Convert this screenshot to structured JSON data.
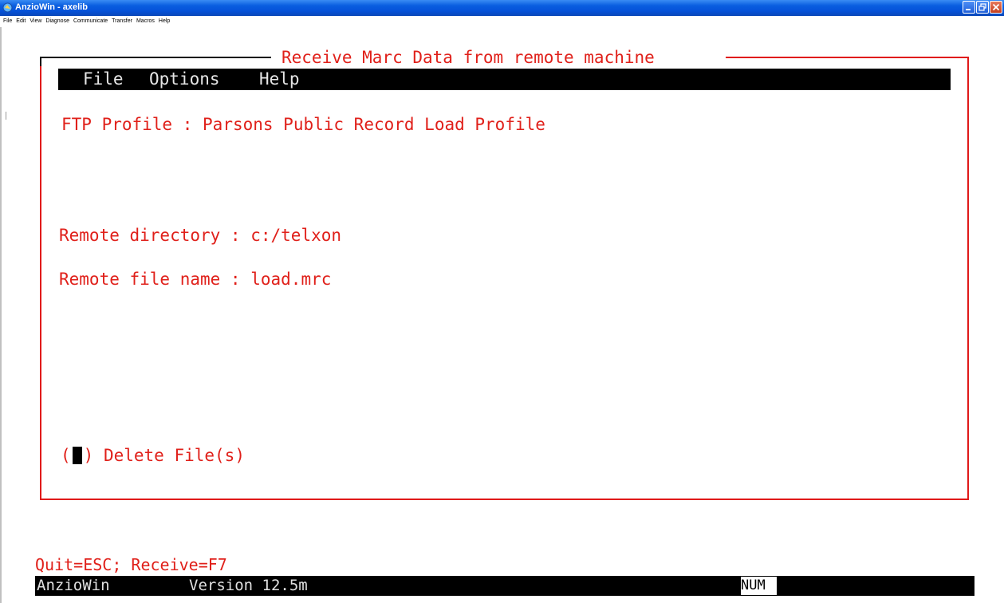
{
  "window": {
    "title": "AnzioWin - axelib"
  },
  "menubar": {
    "items": [
      "File",
      "Edit",
      "View",
      "Diagnose",
      "Communicate",
      "Transfer",
      "Macros",
      "Help"
    ]
  },
  "screen": {
    "frame_title": "Receive Marc Data from remote machine",
    "menu": [
      "File",
      "Options",
      "Help"
    ],
    "ftp_profile_label": "FTP Profile :",
    "ftp_profile_value": "Parsons Public Record Load Profile",
    "remote_directory_label": "Remote directory :",
    "remote_directory_value": "c:/telxon",
    "remote_file_label": "Remote file name :",
    "remote_file_value": "load.mrc",
    "delete_label": "Delete File(s)",
    "delete_checked": false,
    "hint": "Quit=ESC; Receive=F7"
  },
  "status": {
    "app": "AnzioWin",
    "version": "Version 12.5m",
    "num": "NUM"
  },
  "colors": {
    "terminal_text": "#e0201a",
    "frame": "#e01a1a",
    "titlebar": "#0a5ee0"
  }
}
